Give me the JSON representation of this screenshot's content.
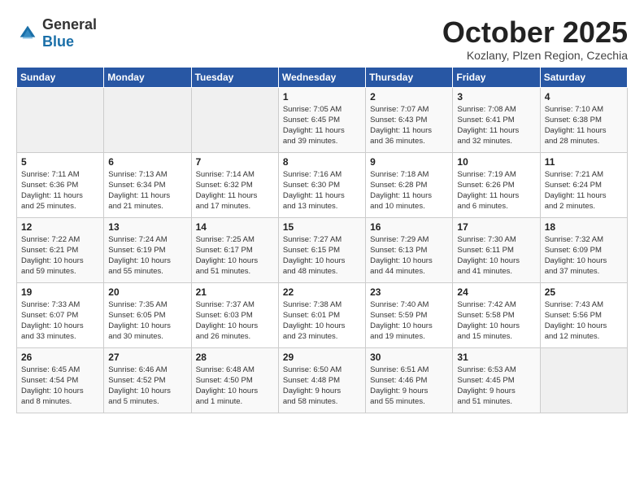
{
  "header": {
    "logo_general": "General",
    "logo_blue": "Blue",
    "month_title": "October 2025",
    "location": "Kozlany, Plzen Region, Czechia"
  },
  "weekdays": [
    "Sunday",
    "Monday",
    "Tuesday",
    "Wednesday",
    "Thursday",
    "Friday",
    "Saturday"
  ],
  "weeks": [
    [
      {
        "day": "",
        "info": ""
      },
      {
        "day": "",
        "info": ""
      },
      {
        "day": "",
        "info": ""
      },
      {
        "day": "1",
        "info": "Sunrise: 7:05 AM\nSunset: 6:45 PM\nDaylight: 11 hours\nand 39 minutes."
      },
      {
        "day": "2",
        "info": "Sunrise: 7:07 AM\nSunset: 6:43 PM\nDaylight: 11 hours\nand 36 minutes."
      },
      {
        "day": "3",
        "info": "Sunrise: 7:08 AM\nSunset: 6:41 PM\nDaylight: 11 hours\nand 32 minutes."
      },
      {
        "day": "4",
        "info": "Sunrise: 7:10 AM\nSunset: 6:38 PM\nDaylight: 11 hours\nand 28 minutes."
      }
    ],
    [
      {
        "day": "5",
        "info": "Sunrise: 7:11 AM\nSunset: 6:36 PM\nDaylight: 11 hours\nand 25 minutes."
      },
      {
        "day": "6",
        "info": "Sunrise: 7:13 AM\nSunset: 6:34 PM\nDaylight: 11 hours\nand 21 minutes."
      },
      {
        "day": "7",
        "info": "Sunrise: 7:14 AM\nSunset: 6:32 PM\nDaylight: 11 hours\nand 17 minutes."
      },
      {
        "day": "8",
        "info": "Sunrise: 7:16 AM\nSunset: 6:30 PM\nDaylight: 11 hours\nand 13 minutes."
      },
      {
        "day": "9",
        "info": "Sunrise: 7:18 AM\nSunset: 6:28 PM\nDaylight: 11 hours\nand 10 minutes."
      },
      {
        "day": "10",
        "info": "Sunrise: 7:19 AM\nSunset: 6:26 PM\nDaylight: 11 hours\nand 6 minutes."
      },
      {
        "day": "11",
        "info": "Sunrise: 7:21 AM\nSunset: 6:24 PM\nDaylight: 11 hours\nand 2 minutes."
      }
    ],
    [
      {
        "day": "12",
        "info": "Sunrise: 7:22 AM\nSunset: 6:21 PM\nDaylight: 10 hours\nand 59 minutes."
      },
      {
        "day": "13",
        "info": "Sunrise: 7:24 AM\nSunset: 6:19 PM\nDaylight: 10 hours\nand 55 minutes."
      },
      {
        "day": "14",
        "info": "Sunrise: 7:25 AM\nSunset: 6:17 PM\nDaylight: 10 hours\nand 51 minutes."
      },
      {
        "day": "15",
        "info": "Sunrise: 7:27 AM\nSunset: 6:15 PM\nDaylight: 10 hours\nand 48 minutes."
      },
      {
        "day": "16",
        "info": "Sunrise: 7:29 AM\nSunset: 6:13 PM\nDaylight: 10 hours\nand 44 minutes."
      },
      {
        "day": "17",
        "info": "Sunrise: 7:30 AM\nSunset: 6:11 PM\nDaylight: 10 hours\nand 41 minutes."
      },
      {
        "day": "18",
        "info": "Sunrise: 7:32 AM\nSunset: 6:09 PM\nDaylight: 10 hours\nand 37 minutes."
      }
    ],
    [
      {
        "day": "19",
        "info": "Sunrise: 7:33 AM\nSunset: 6:07 PM\nDaylight: 10 hours\nand 33 minutes."
      },
      {
        "day": "20",
        "info": "Sunrise: 7:35 AM\nSunset: 6:05 PM\nDaylight: 10 hours\nand 30 minutes."
      },
      {
        "day": "21",
        "info": "Sunrise: 7:37 AM\nSunset: 6:03 PM\nDaylight: 10 hours\nand 26 minutes."
      },
      {
        "day": "22",
        "info": "Sunrise: 7:38 AM\nSunset: 6:01 PM\nDaylight: 10 hours\nand 23 minutes."
      },
      {
        "day": "23",
        "info": "Sunrise: 7:40 AM\nSunset: 5:59 PM\nDaylight: 10 hours\nand 19 minutes."
      },
      {
        "day": "24",
        "info": "Sunrise: 7:42 AM\nSunset: 5:58 PM\nDaylight: 10 hours\nand 15 minutes."
      },
      {
        "day": "25",
        "info": "Sunrise: 7:43 AM\nSunset: 5:56 PM\nDaylight: 10 hours\nand 12 minutes."
      }
    ],
    [
      {
        "day": "26",
        "info": "Sunrise: 6:45 AM\nSunset: 4:54 PM\nDaylight: 10 hours\nand 8 minutes."
      },
      {
        "day": "27",
        "info": "Sunrise: 6:46 AM\nSunset: 4:52 PM\nDaylight: 10 hours\nand 5 minutes."
      },
      {
        "day": "28",
        "info": "Sunrise: 6:48 AM\nSunset: 4:50 PM\nDaylight: 10 hours\nand 1 minute."
      },
      {
        "day": "29",
        "info": "Sunrise: 6:50 AM\nSunset: 4:48 PM\nDaylight: 9 hours\nand 58 minutes."
      },
      {
        "day": "30",
        "info": "Sunrise: 6:51 AM\nSunset: 4:46 PM\nDaylight: 9 hours\nand 55 minutes."
      },
      {
        "day": "31",
        "info": "Sunrise: 6:53 AM\nSunset: 4:45 PM\nDaylight: 9 hours\nand 51 minutes."
      },
      {
        "day": "",
        "info": ""
      }
    ]
  ]
}
